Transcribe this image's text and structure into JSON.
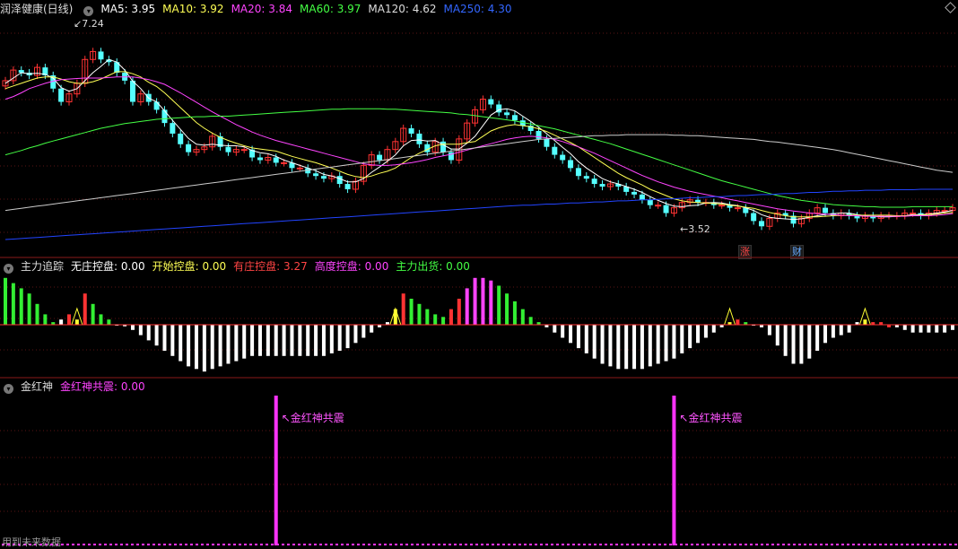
{
  "header": {
    "title": "润泽健康(日线)",
    "ma": [
      {
        "label": "MA5: 3.95",
        "color": "#ffffff"
      },
      {
        "label": "MA10: 3.92",
        "color": "#ffff55"
      },
      {
        "label": "MA20: 3.84",
        "color": "#ff44ff"
      },
      {
        "label": "MA60: 3.97",
        "color": "#44ff44"
      },
      {
        "label": "MA120: 4.62",
        "color": "#dddddd"
      },
      {
        "label": "MA250: 4.30",
        "color": "#3366ff"
      }
    ]
  },
  "price_labels": {
    "high": "7.24",
    "low": "3.52"
  },
  "tags": {
    "zhang": "涨",
    "cai": "财"
  },
  "indicator1": {
    "name": "主力追踪",
    "items": [
      {
        "label": "无庄控盘: 0.00",
        "color": "#ffffff"
      },
      {
        "label": "开始控盘: 0.00",
        "color": "#ffff55"
      },
      {
        "label": "有庄控盘: 3.27",
        "color": "#ff4444"
      },
      {
        "label": "高度控盘: 0.00",
        "color": "#ff44ff"
      },
      {
        "label": "主力出货: 0.00",
        "color": "#44ff44"
      }
    ]
  },
  "indicator2": {
    "name": "金红神",
    "items": [
      {
        "label": "金红神共震: 0.00",
        "color": "#ff44ff"
      }
    ],
    "signal_label": "金红神共震"
  },
  "footer_note": "用到未来数据",
  "chart_data": [
    {
      "type": "candlestick",
      "title": "润泽健康(日线)",
      "ylim": [
        3.3,
        7.5
      ],
      "marked_high": 7.24,
      "marked_low": 3.52,
      "close": [
        6.35,
        6.55,
        6.5,
        6.45,
        6.6,
        6.45,
        6.2,
        5.95,
        6.1,
        6.3,
        6.75,
        6.9,
        6.75,
        6.7,
        6.5,
        6.35,
        5.95,
        6.1,
        5.95,
        5.8,
        5.55,
        5.35,
        5.15,
        5.0,
        5.05,
        5.1,
        5.3,
        5.1,
        5.0,
        5.05,
        5.05,
        4.9,
        4.85,
        4.9,
        4.8,
        4.8,
        4.7,
        4.7,
        4.6,
        4.55,
        4.5,
        4.55,
        4.4,
        4.3,
        4.45,
        4.75,
        4.95,
        4.85,
        5.05,
        5.2,
        5.45,
        5.35,
        5.15,
        5.0,
        5.2,
        5.0,
        4.85,
        5.25,
        5.55,
        5.8,
        6.0,
        5.9,
        5.75,
        5.7,
        5.6,
        5.5,
        5.4,
        5.25,
        5.1,
        4.95,
        4.85,
        4.7,
        4.55,
        4.5,
        4.4,
        4.35,
        4.4,
        4.35,
        4.25,
        4.2,
        4.1,
        4.0,
        4.0,
        3.85,
        3.95,
        4.05,
        4.1,
        4.05,
        4.05,
        4.0,
        4.0,
        3.95,
        3.95,
        3.85,
        3.7,
        3.6,
        3.75,
        3.85,
        3.8,
        3.65,
        3.75,
        3.85,
        3.95,
        3.85,
        3.8,
        3.85,
        3.8,
        3.75,
        3.8,
        3.75,
        3.8,
        3.8,
        3.8,
        3.85,
        3.85,
        3.8,
        3.85,
        3.9,
        3.9,
        3.95
      ],
      "series": [
        {
          "name": "MA5",
          "values": [
            6.3,
            6.4,
            6.5,
            6.48,
            6.49,
            6.47,
            6.4,
            6.22,
            6.15,
            6.2,
            6.35,
            6.5,
            6.62,
            6.75,
            6.7,
            6.55,
            6.34,
            6.2,
            6.02,
            5.95,
            5.78,
            5.6,
            5.43,
            5.26,
            5.15,
            5.13,
            5.15,
            5.13,
            5.12,
            5.12,
            5.1,
            5.03,
            4.99,
            4.97,
            4.92,
            4.85,
            4.8,
            4.75,
            4.7,
            4.65,
            4.58,
            4.55,
            4.5,
            4.44,
            4.44,
            4.5,
            4.62,
            4.72,
            4.83,
            4.95,
            5.12,
            5.22,
            5.23,
            5.21,
            5.22,
            5.14,
            5.06,
            5.06,
            5.17,
            5.3,
            5.5,
            5.7,
            5.8,
            5.82,
            5.78,
            5.68,
            5.58,
            5.47,
            5.35,
            5.22,
            5.09,
            4.97,
            4.82,
            4.7,
            4.6,
            4.5,
            4.44,
            4.4,
            4.35,
            4.3,
            4.24,
            4.16,
            4.09,
            4.03,
            3.98,
            3.97,
            3.99,
            4.0,
            4.04,
            4.05,
            4.04,
            4.01,
            3.99,
            3.95,
            3.9,
            3.82,
            3.77,
            3.75,
            3.74,
            3.73,
            3.74,
            3.77,
            3.8,
            3.82,
            3.84,
            3.85,
            3.85,
            3.82,
            3.8,
            3.79,
            3.78,
            3.78,
            3.79,
            3.8,
            3.82,
            3.82,
            3.83,
            3.85,
            3.87,
            3.9
          ]
        },
        {
          "name": "MA10",
          "values": [
            6.2,
            6.25,
            6.3,
            6.35,
            6.4,
            6.42,
            6.42,
            6.38,
            6.33,
            6.3,
            6.3,
            6.33,
            6.38,
            6.45,
            6.52,
            6.52,
            6.48,
            6.42,
            6.32,
            6.24,
            6.12,
            5.98,
            5.84,
            5.7,
            5.56,
            5.45,
            5.36,
            5.28,
            5.22,
            5.17,
            5.12,
            5.08,
            5.06,
            5.04,
            5.02,
            4.97,
            4.92,
            4.88,
            4.84,
            4.8,
            4.75,
            4.7,
            4.64,
            4.58,
            4.54,
            4.52,
            4.55,
            4.6,
            4.64,
            4.7,
            4.8,
            4.9,
            4.98,
            5.05,
            5.12,
            5.15,
            5.15,
            5.15,
            5.18,
            5.2,
            5.3,
            5.4,
            5.46,
            5.5,
            5.52,
            5.5,
            5.48,
            5.44,
            5.39,
            5.32,
            5.25,
            5.18,
            5.1,
            5.0,
            4.9,
            4.8,
            4.7,
            4.6,
            4.52,
            4.45,
            4.38,
            4.3,
            4.24,
            4.18,
            4.12,
            4.08,
            4.06,
            4.05,
            4.04,
            4.03,
            4.02,
            4.0,
            3.98,
            3.96,
            3.94,
            3.9,
            3.86,
            3.83,
            3.8,
            3.78,
            3.78,
            3.78,
            3.78,
            3.79,
            3.8,
            3.81,
            3.81,
            3.81,
            3.81,
            3.81,
            3.81,
            3.81,
            3.8,
            3.8,
            3.8,
            3.81,
            3.82,
            3.83,
            3.85,
            3.86
          ]
        },
        {
          "name": "MA20",
          "values": [
            6.0,
            6.05,
            6.12,
            6.2,
            6.25,
            6.3,
            6.34,
            6.37,
            6.38,
            6.39,
            6.4,
            6.4,
            6.4,
            6.41,
            6.42,
            6.42,
            6.42,
            6.4,
            6.37,
            6.33,
            6.28,
            6.2,
            6.12,
            6.03,
            5.94,
            5.85,
            5.76,
            5.68,
            5.6,
            5.52,
            5.45,
            5.38,
            5.32,
            5.27,
            5.22,
            5.18,
            5.14,
            5.1,
            5.06,
            5.02,
            4.98,
            4.94,
            4.9,
            4.86,
            4.82,
            4.78,
            4.76,
            4.75,
            4.75,
            4.76,
            4.78,
            4.8,
            4.83,
            4.86,
            4.9,
            4.93,
            4.96,
            5.0,
            5.04,
            5.08,
            5.12,
            5.16,
            5.2,
            5.24,
            5.27,
            5.29,
            5.3,
            5.29,
            5.27,
            5.24,
            5.2,
            5.15,
            5.1,
            5.04,
            4.98,
            4.91,
            4.84,
            4.77,
            4.7,
            4.63,
            4.56,
            4.5,
            4.44,
            4.39,
            4.34,
            4.3,
            4.26,
            4.23,
            4.2,
            4.17,
            4.14,
            4.11,
            4.08,
            4.05,
            4.02,
            3.99,
            3.96,
            3.93,
            3.91,
            3.89,
            3.87,
            3.85,
            3.84,
            3.83,
            3.82,
            3.81,
            3.8,
            3.8,
            3.79,
            3.79,
            3.79,
            3.79,
            3.79,
            3.79,
            3.8,
            3.8,
            3.8,
            3.81,
            3.82,
            3.84
          ]
        },
        {
          "name": "MA60",
          "values": [
            4.95,
            4.99,
            5.03,
            5.08,
            5.12,
            5.17,
            5.21,
            5.25,
            5.29,
            5.33,
            5.37,
            5.41,
            5.45,
            5.48,
            5.51,
            5.54,
            5.56,
            5.58,
            5.6,
            5.62,
            5.63,
            5.64,
            5.65,
            5.66,
            5.67,
            5.67,
            5.68,
            5.68,
            5.68,
            5.69,
            5.7,
            5.71,
            5.72,
            5.73,
            5.74,
            5.75,
            5.76,
            5.77,
            5.78,
            5.79,
            5.8,
            5.81,
            5.81,
            5.82,
            5.82,
            5.82,
            5.82,
            5.82,
            5.81,
            5.81,
            5.8,
            5.79,
            5.78,
            5.77,
            5.76,
            5.75,
            5.74,
            5.72,
            5.71,
            5.69,
            5.67,
            5.65,
            5.63,
            5.61,
            5.59,
            5.56,
            5.53,
            5.5,
            5.47,
            5.44,
            5.4,
            5.36,
            5.32,
            5.28,
            5.24,
            5.2,
            5.16,
            5.11,
            5.06,
            5.01,
            4.96,
            4.91,
            4.86,
            4.81,
            4.76,
            4.71,
            4.66,
            4.61,
            4.56,
            4.51,
            4.46,
            4.42,
            4.38,
            4.34,
            4.3,
            4.26,
            4.22,
            4.18,
            4.15,
            4.12,
            4.09,
            4.07,
            4.05,
            4.03,
            4.01,
            4.0,
            3.99,
            3.98,
            3.97,
            3.97,
            3.96,
            3.96,
            3.96,
            3.96,
            3.97,
            3.97,
            3.97,
            3.97,
            3.97,
            3.97
          ]
        },
        {
          "name": "MA120",
          "values": [
            3.9,
            3.92,
            3.94,
            3.96,
            3.98,
            4.0,
            4.02,
            4.04,
            4.06,
            4.08,
            4.1,
            4.12,
            4.14,
            4.16,
            4.18,
            4.2,
            4.22,
            4.24,
            4.26,
            4.28,
            4.3,
            4.32,
            4.34,
            4.36,
            4.38,
            4.4,
            4.42,
            4.44,
            4.46,
            4.48,
            4.5,
            4.52,
            4.54,
            4.56,
            4.58,
            4.6,
            4.62,
            4.64,
            4.66,
            4.68,
            4.7,
            4.72,
            4.74,
            4.76,
            4.78,
            4.8,
            4.82,
            4.84,
            4.86,
            4.88,
            4.9,
            4.92,
            4.94,
            4.96,
            4.98,
            5.0,
            5.02,
            5.04,
            5.06,
            5.08,
            5.1,
            5.12,
            5.14,
            5.16,
            5.18,
            5.2,
            5.22,
            5.24,
            5.25,
            5.26,
            5.27,
            5.28,
            5.29,
            5.3,
            5.31,
            5.31,
            5.32,
            5.32,
            5.33,
            5.33,
            5.33,
            5.33,
            5.33,
            5.33,
            5.32,
            5.32,
            5.31,
            5.31,
            5.3,
            5.29,
            5.28,
            5.27,
            5.26,
            5.25,
            5.24,
            5.22,
            5.2,
            5.19,
            5.17,
            5.15,
            5.13,
            5.11,
            5.09,
            5.07,
            5.05,
            5.02,
            4.99,
            4.96,
            4.93,
            4.9,
            4.87,
            4.84,
            4.81,
            4.78,
            4.75,
            4.72,
            4.69,
            4.66,
            4.64,
            4.62
          ]
        },
        {
          "name": "MA250",
          "values": [
            3.35,
            3.36,
            3.37,
            3.38,
            3.39,
            3.4,
            3.41,
            3.42,
            3.43,
            3.44,
            3.45,
            3.46,
            3.47,
            3.48,
            3.49,
            3.5,
            3.51,
            3.52,
            3.53,
            3.54,
            3.55,
            3.56,
            3.57,
            3.58,
            3.59,
            3.6,
            3.61,
            3.62,
            3.63,
            3.64,
            3.65,
            3.66,
            3.67,
            3.68,
            3.69,
            3.7,
            3.71,
            3.72,
            3.73,
            3.74,
            3.75,
            3.76,
            3.77,
            3.78,
            3.79,
            3.8,
            3.81,
            3.82,
            3.83,
            3.84,
            3.85,
            3.86,
            3.87,
            3.88,
            3.89,
            3.9,
            3.91,
            3.92,
            3.93,
            3.94,
            3.95,
            3.96,
            3.97,
            3.98,
            3.99,
            4.0,
            4.0,
            4.01,
            4.02,
            4.02,
            4.03,
            4.04,
            4.04,
            4.05,
            4.06,
            4.06,
            4.07,
            4.08,
            4.08,
            4.09,
            4.1,
            4.1,
            4.11,
            4.12,
            4.12,
            4.13,
            4.14,
            4.14,
            4.15,
            4.16,
            4.16,
            4.17,
            4.18,
            4.18,
            4.19,
            4.2,
            4.2,
            4.21,
            4.22,
            4.22,
            4.23,
            4.24,
            4.24,
            4.25,
            4.26,
            4.26,
            4.27,
            4.27,
            4.28,
            4.28,
            4.28,
            4.29,
            4.29,
            4.29,
            4.29,
            4.3,
            4.3,
            4.3,
            4.3,
            4.3
          ]
        }
      ]
    },
    {
      "type": "bar",
      "title": "主力追踪",
      "values": [
        9,
        8,
        7,
        6,
        4,
        2,
        0.5,
        1,
        2,
        1,
        6,
        4,
        2,
        1,
        0,
        -0.3,
        -1,
        -2,
        -3,
        -4,
        -5,
        -6,
        -7,
        -8,
        -8.5,
        -9,
        -8.5,
        -8,
        -7.5,
        -7,
        -6.5,
        -6,
        -6,
        -6,
        -6,
        -6,
        -6,
        -6,
        -6,
        -6,
        -6,
        -5.5,
        -5,
        -4.5,
        -3.5,
        -2.5,
        -1.5,
        -0.5,
        0.5,
        3,
        6,
        5,
        4,
        3,
        2,
        1.5,
        3,
        5,
        7,
        9,
        9,
        8.5,
        7.5,
        6,
        4.5,
        3,
        1.5,
        0.5,
        -0.5,
        -1.5,
        -2.5,
        -3.5,
        -4.5,
        -5.5,
        -6.5,
        -7.5,
        -8,
        -8.5,
        -8.5,
        -8.5,
        -8.5,
        -8,
        -7.5,
        -7,
        -6.5,
        -5.5,
        -4.5,
        -3.5,
        -2.5,
        -1.5,
        -0.5,
        0.5,
        1,
        0.5,
        0,
        -0.5,
        -2,
        -4,
        -6,
        -7.5,
        -7.5,
        -6.5,
        -5,
        -3.5,
        -2.5,
        -2,
        -1.5,
        0.5,
        1,
        0.5,
        0.5,
        -0.5,
        -0.5,
        -1,
        -1.5,
        -1.5,
        -1.5,
        -1.5,
        -1.5,
        -1,
        -0.5
      ],
      "colors": [
        "g",
        "g",
        "g",
        "g",
        "g",
        "g",
        "g",
        "w",
        "r",
        "y",
        "r",
        "g",
        "g",
        "g",
        "w",
        "w",
        "w",
        "w",
        "w",
        "w",
        "w",
        "w",
        "w",
        "w",
        "w",
        "w",
        "w",
        "w",
        "w",
        "w",
        "w",
        "w",
        "w",
        "w",
        "w",
        "w",
        "w",
        "w",
        "w",
        "w",
        "w",
        "w",
        "w",
        "w",
        "w",
        "w",
        "w",
        "w",
        "w",
        "y",
        "r",
        "g",
        "g",
        "g",
        "g",
        "g",
        "r",
        "r",
        "m",
        "m",
        "m",
        "m",
        "g",
        "g",
        "g",
        "g",
        "g",
        "g",
        "w",
        "w",
        "w",
        "w",
        "w",
        "w",
        "w",
        "w",
        "w",
        "w",
        "w",
        "w",
        "w",
        "w",
        "w",
        "w",
        "w",
        "w",
        "w",
        "w",
        "w",
        "w",
        "w",
        "y",
        "r",
        "g",
        "w",
        "w",
        "w",
        "w",
        "w",
        "w",
        "w",
        "w",
        "w",
        "w",
        "w",
        "w",
        "w",
        "w",
        "y",
        "r",
        "r",
        "r",
        "w",
        "w",
        "w",
        "w",
        "w",
        "w",
        "w",
        "w",
        "w",
        "w"
      ]
    },
    {
      "type": "bar",
      "title": "金红神",
      "signals": [
        34,
        84
      ],
      "values_note": "signal bars at x positions"
    }
  ]
}
